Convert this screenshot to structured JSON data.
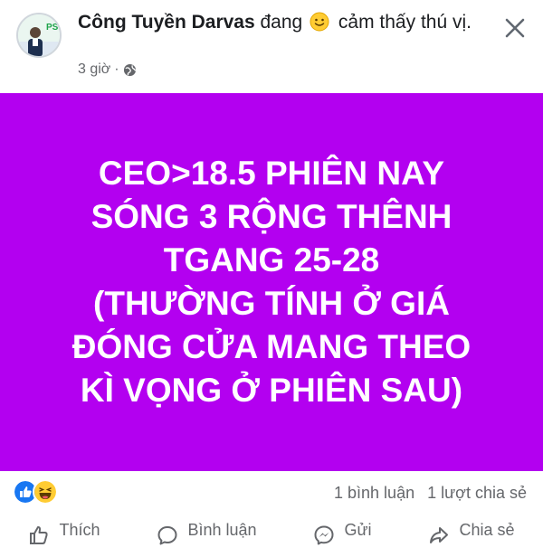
{
  "post": {
    "author": "Công Tuyền Darvas",
    "activity_prefix": "đang",
    "feeling": "cảm thấy thú vị.",
    "time": "3 giờ",
    "separator": "·",
    "avatar_text": "PSC",
    "privacy_icon": "globe-icon",
    "feeling_icon": "smiling-face-icon"
  },
  "banner": {
    "text": "CEO>18.5 PHIÊN NAY\nSÓNG 3 RỘNG THÊNH\nTGANG 25-28\n(THƯỜNG TÍNH Ở GIÁ\nĐÓNG CỬA MANG THEO\nKÌ VỌNG Ở PHIÊN SAU)",
    "background_color": "#b300f0",
    "text_color": "#ffffff"
  },
  "engagement": {
    "reactions": [
      "like-icon",
      "haha-icon"
    ],
    "comments": "1 bình luận",
    "shares": "1 lượt chia sẻ"
  },
  "actions": {
    "like": "Thích",
    "comment": "Bình luận",
    "send": "Gửi",
    "share": "Chia sẻ"
  },
  "colors": {
    "accent_blue": "#1877f2",
    "secondary_text": "#65676b"
  }
}
